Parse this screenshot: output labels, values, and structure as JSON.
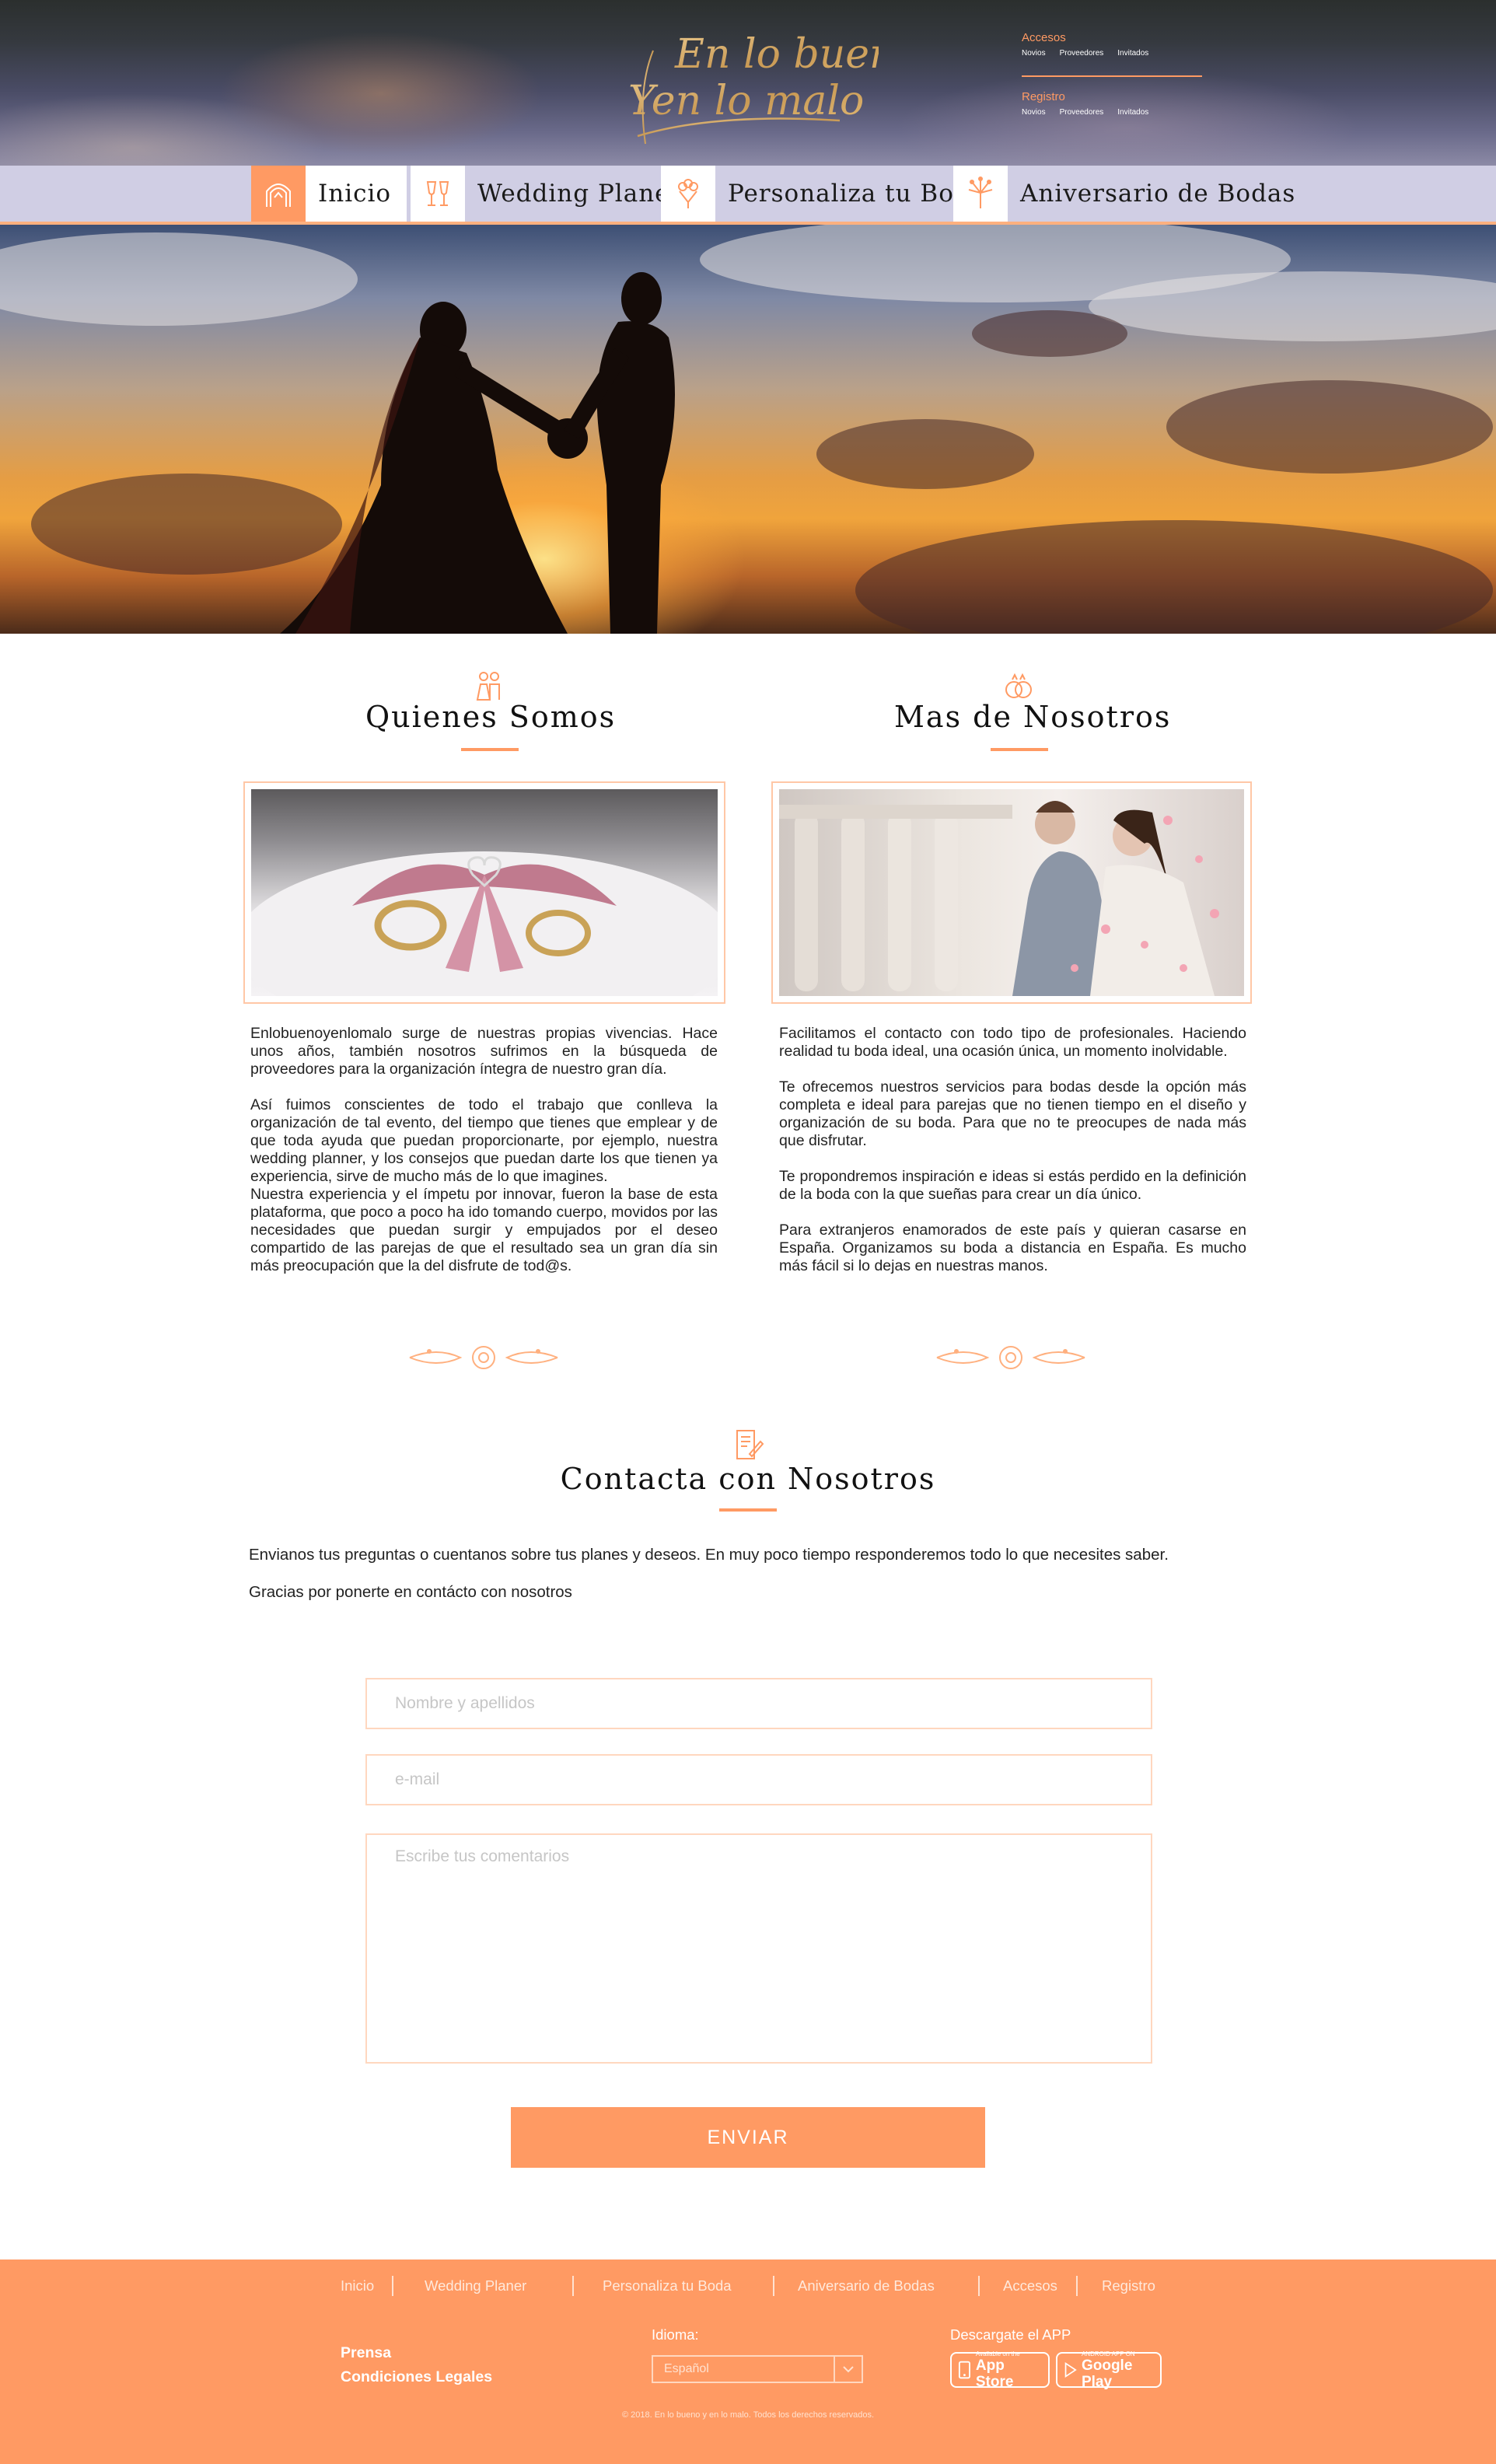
{
  "colors": {
    "accent": "#ff9a63",
    "accent_light": "#ffc7a6",
    "nav_bg": "#d0cee4",
    "text": "#222222",
    "footer_text": "#ffffff"
  },
  "header": {
    "logo_line1": "En lo bueno",
    "logo_line2": "Yen lo malo",
    "access": {
      "title": "Accesos",
      "links": [
        "Novios",
        "Proveedores",
        "Invitados"
      ]
    },
    "register": {
      "title": "Registro",
      "links": [
        "Novios",
        "Proveedores",
        "Invitados"
      ]
    }
  },
  "nav": {
    "items": [
      {
        "label": "Inicio",
        "icon": "wedding-arch-icon",
        "active": true
      },
      {
        "label": "Wedding Planer",
        "icon": "champagne-glasses-icon",
        "active": false
      },
      {
        "label": "Personaliza tu Boda",
        "icon": "flower-bouquet-icon",
        "active": false
      },
      {
        "label": "Aniversario de Bodas",
        "icon": "fireworks-icon",
        "active": false
      }
    ]
  },
  "hero": {
    "image": "couple-silhouette-sunset"
  },
  "about": {
    "left": {
      "icon": "bride-groom-icon",
      "title": "Quienes Somos",
      "image": "wedding-rings-on-pillow",
      "paragraphs": [
        "Enlobuenoyenlomalo surge de nuestras propias vivencias. Hace unos años, también nosotros sufrimos en la búsqueda de proveedores para la organización íntegra de nuestro gran día.",
        "Así fuimos conscientes de todo el trabajo que conlleva la organización de tal evento, del tiempo que tienes que emplear y de que toda ayuda que puedan proporcionarte, por ejemplo, nuestra wedding planner, y los consejos que puedan darte los que tienen ya experiencia, sirve de mucho más de lo que imagines.",
        "Nuestra experiencia y el ímpetu por innovar, fueron la base de esta plataforma, que poco a poco ha ido tomando cuerpo, movidos por las necesidades que puedan surgir y empujados por el deseo compartido de las parejas de que el resultado sea un gran día sin más preocupación que la del disfrute de tod@s."
      ]
    },
    "right": {
      "icon": "wedding-rings-icon",
      "title": "Mas de Nosotros",
      "image": "couple-with-petals",
      "paragraphs": [
        "Facilitamos el contacto con todo tipo de profesionales. Haciendo realidad tu boda ideal, una ocasión única, un momento inolvidable.",
        "Te ofrecemos nuestros servicios para bodas desde la opción más completa e ideal para parejas que no tienen tiempo en el diseño y organización de su boda. Para que no te preocupes de nada más que disfrutar.",
        "Te propondremos inspiración e ideas si estás perdido en la definición de la boda con la que sueñas para crear un día único.",
        "Para extranjeros enamorados de este país y quieran casarse en España. Organizamos su boda a distancia en España. Es mucho más fácil si lo dejas en nuestras manos."
      ]
    }
  },
  "contact": {
    "icon": "document-pen-icon",
    "title": "Contacta con Nosotros",
    "intro1": "Envianos tus preguntas o cuentanos sobre tus planes y deseos. En muy poco tiempo responderemos todo lo que necesites saber.",
    "intro2": "Gracias por ponerte en contácto con nosotros",
    "name_placeholder": "Nombre y apellidos",
    "email_placeholder": "e-mail",
    "comments_placeholder": "Escribe tus comentarios",
    "submit_label": "ENVIAR"
  },
  "footer": {
    "nav": [
      "Inicio",
      "Wedding Planer",
      "Personaliza tu Boda",
      "Aniversario de Bodas",
      "Accesos",
      "Registro"
    ],
    "links": [
      "Prensa",
      "Condiciones Legales"
    ],
    "language_label": "Idioma:",
    "language_value": "Español",
    "app_label": "Descargate el APP",
    "appstore_small": "Available on the",
    "appstore_big": "App Store",
    "googleplay_small": "ANDROID APP ON",
    "googleplay_big": "Google Play",
    "copyright": "© 2018. En lo bueno y en lo malo. Todos los derechos reservados."
  }
}
